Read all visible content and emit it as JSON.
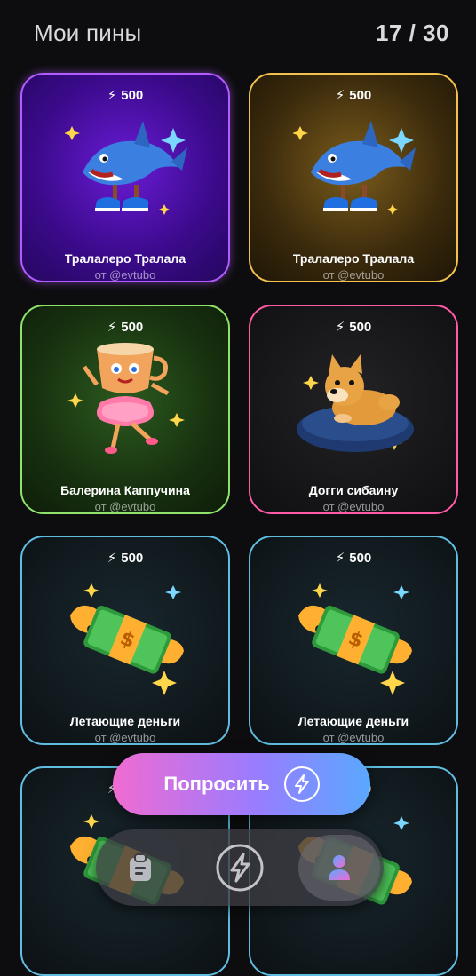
{
  "header": {
    "title": "Мои пины",
    "counter": "17 / 30"
  },
  "pins": [
    {
      "cost": "500",
      "name": "Тралалеро Тралала",
      "author": "от @evtubo",
      "theme": "purple",
      "art": "shark"
    },
    {
      "cost": "500",
      "name": "Тралалеро Тралала",
      "author": "от @evtubo",
      "theme": "gold",
      "art": "shark"
    },
    {
      "cost": "500",
      "name": "Балерина Каппучина",
      "author": "от @evtubo",
      "theme": "green",
      "art": "ballerina-cup"
    },
    {
      "cost": "500",
      "name": "Догги сибаину",
      "author": "от @evtubo",
      "theme": "dark",
      "art": "shiba-dog"
    },
    {
      "cost": "500",
      "name": "Летающие деньги",
      "author": "от @evtubo",
      "theme": "blue",
      "art": "flying-money"
    },
    {
      "cost": "500",
      "name": "Летающие деньги",
      "author": "от @evtubo",
      "theme": "blue",
      "art": "flying-money"
    },
    {
      "cost": "500",
      "name": "",
      "author": "",
      "theme": "blue",
      "art": "flying-money"
    },
    {
      "cost": "500",
      "name": "",
      "author": "",
      "theme": "blue",
      "art": "flying-money"
    }
  ],
  "action_button": {
    "label": "Попросить",
    "icon": "lightning-icon"
  },
  "bottom_nav": {
    "items": [
      {
        "icon": "clipboard-icon",
        "active": false
      },
      {
        "icon": "lightning-icon",
        "active": false
      },
      {
        "icon": "user-icon",
        "active": true
      }
    ]
  },
  "colors": {
    "background": "#0d0d0f",
    "purple_border": "#b35cff",
    "gold_border": "#f2c14e",
    "green_border": "#8fe36a",
    "pink_border": "#ff5aa6",
    "blue_border": "#5fbde0",
    "button_gradient": [
      "#f06bd2",
      "#9a7cff",
      "#5aa8ff"
    ]
  }
}
